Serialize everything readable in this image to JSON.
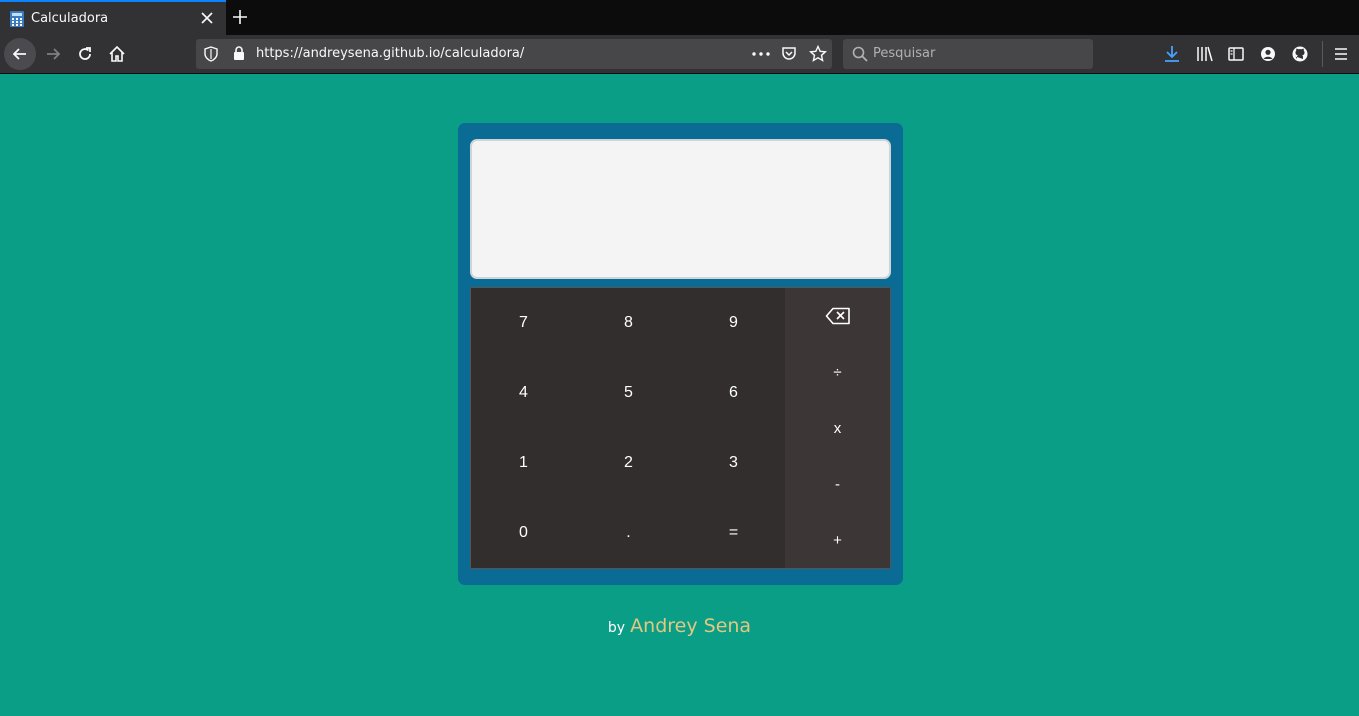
{
  "browser": {
    "tab_title": "Calculadora",
    "url": "https://andreysena.github.io/calculadora/",
    "search_placeholder": "Pesquisar"
  },
  "calculator": {
    "display_value": "",
    "digit_keys": [
      "7",
      "8",
      "9",
      "4",
      "5",
      "6",
      "1",
      "2",
      "3",
      "0",
      ".",
      "="
    ],
    "operator_keys": [
      "÷",
      "x",
      "-",
      "+"
    ],
    "backspace_icon": "backspace-icon",
    "colors": {
      "page_background": "#0a9e87",
      "calculator_frame": "#0a6c94",
      "keypad": "#322e2e",
      "operators": "#3c3636",
      "display": "#f4f4f4",
      "author_link": "#e3c782"
    }
  },
  "footer": {
    "by": "by",
    "author": "Andrey Sena"
  }
}
